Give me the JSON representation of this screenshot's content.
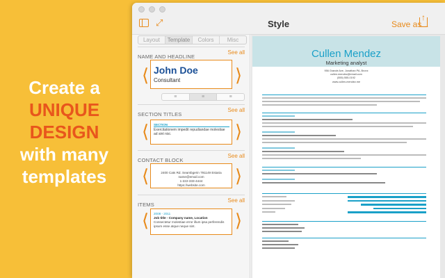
{
  "promo": {
    "line1": "Create a",
    "line2": "UNIQUE",
    "line3": "DESIGN",
    "line4": "with many",
    "line5": "templates"
  },
  "toolbar": {
    "title": "Style",
    "save_label": "Save as...",
    "icons": [
      "sidebar-icon",
      "expand-icon",
      "share-icon"
    ]
  },
  "tabs": [
    {
      "label": "Layout"
    },
    {
      "label": "Template"
    },
    {
      "label": "Colors"
    },
    {
      "label": "Misc"
    }
  ],
  "sections": {
    "name": {
      "label": "NAME AND HEADLINE",
      "see_all": "See all",
      "preview_name": "John Doe",
      "preview_headline": "Consultant"
    },
    "alignment": [
      "≡",
      "≡",
      "≡"
    ],
    "titles": {
      "label": "SECTION TITLES",
      "see_all": "See all",
      "preview_section": "SECTION",
      "preview_text": "Exercitationem impedit repudiandae molestiae ad sint nisi."
    },
    "contact": {
      "label": "CONTACT BLOCK",
      "see_all": "See all",
      "line1": "2400 Cats Rd. Seambgerin 791149 Estaria",
      "line2": "name@email.com",
      "line3": "1-222-333-4444",
      "line4": "https://website.com"
    },
    "items": {
      "label": "ITEMS",
      "see_all": "See all",
      "date": "2008 - 2011",
      "job": "Job title - Company name, Location",
      "text": "Consectetur molestiae error illum ipsa perferendis ipsum esse atque neque sint."
    }
  },
  "resume": {
    "name": "Cullen Mendez",
    "headline": "Marketing analyst",
    "address": "956 Grande Ave, Jonathan PA, Bronx",
    "email": "cullen.mendez@email.com",
    "phone": "(555) 555-0192",
    "web": "www.cullen-mendez.me"
  }
}
